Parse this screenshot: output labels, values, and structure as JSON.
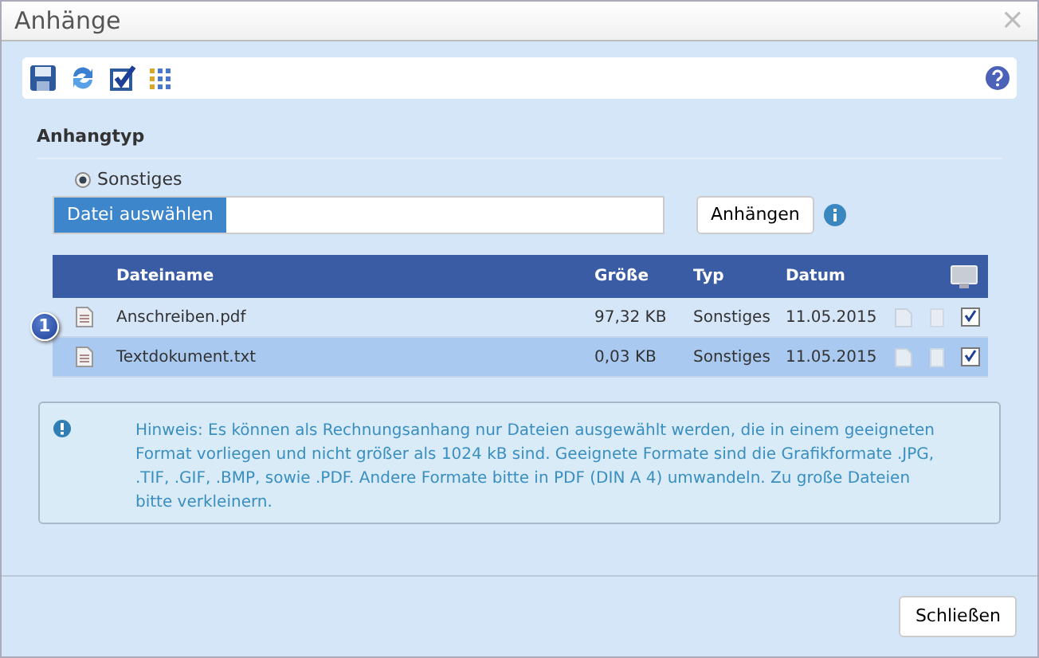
{
  "window": {
    "title": "Anhänge",
    "close": "×"
  },
  "section": {
    "title": "Anhangtyp"
  },
  "radios": [
    {
      "label": "Sonstiges",
      "selected": true
    }
  ],
  "file_picker": {
    "button": "Datei auswählen"
  },
  "attach_button": "Anhängen",
  "marker": "1",
  "table": {
    "columns": [
      "Dateiname",
      "Größe",
      "Typ",
      "Datum"
    ],
    "rows": [
      {
        "name": "Anschreiben.pdf",
        "size": "97,32 KB",
        "type": "Sonstiges",
        "date": "11.05.2015",
        "selected": false,
        "checked": true
      },
      {
        "name": "Textdokument.txt",
        "size": "0,03 KB",
        "type": "Sonstiges",
        "date": "11.05.2015",
        "selected": true,
        "checked": true
      }
    ]
  },
  "notice": "Hinweis: Es können als Rechnungsanhang nur Dateien ausgewählt werden, die in einem geeigneten Format vorliegen und nicht größer als 1024 kB sind. Geeignete Formate sind die Grafikformate .JPG, .TIF, .GIF, .BMP, sowie .PDF. Andere Formate bitte in PDF (DIN A 4) umwandeln. Zu große Dateien bitte verkleinern.",
  "footer_button": "Schließen"
}
